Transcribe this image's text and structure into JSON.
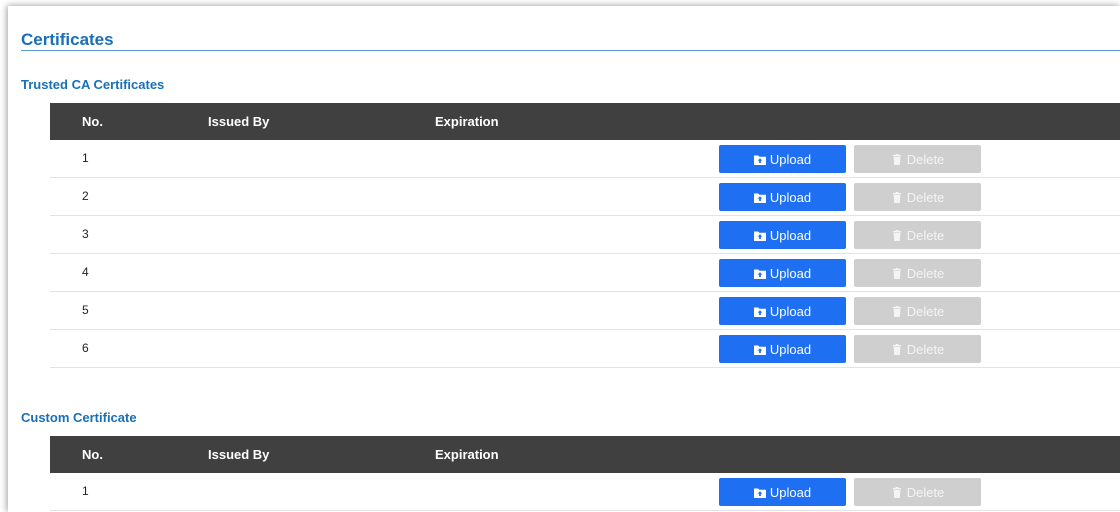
{
  "page": {
    "title": "Certificates"
  },
  "trusted": {
    "title": "Trusted CA Certificates",
    "columns": {
      "no": "No.",
      "issued_by": "Issued By",
      "expiration": "Expiration"
    },
    "rows": [
      {
        "no": "1",
        "upload_label": "Upload",
        "delete_label": "Delete"
      },
      {
        "no": "2",
        "upload_label": "Upload",
        "delete_label": "Delete"
      },
      {
        "no": "3",
        "upload_label": "Upload",
        "delete_label": "Delete"
      },
      {
        "no": "4",
        "upload_label": "Upload",
        "delete_label": "Delete"
      },
      {
        "no": "5",
        "upload_label": "Upload",
        "delete_label": "Delete"
      },
      {
        "no": "6",
        "upload_label": "Upload",
        "delete_label": "Delete"
      }
    ]
  },
  "custom": {
    "title": "Custom Certificate",
    "columns": {
      "no": "No.",
      "issued_by": "Issued By",
      "expiration": "Expiration"
    },
    "rows": [
      {
        "no": "1",
        "upload_label": "Upload",
        "delete_label": "Delete"
      }
    ]
  },
  "icons": {
    "upload": "folder-upload-icon",
    "delete": "trash-icon"
  },
  "colors": {
    "accent": "#1a6fb7",
    "upload_button": "#1e6ff2",
    "delete_button_disabled": "#cfcfcf",
    "table_header": "#404040"
  }
}
